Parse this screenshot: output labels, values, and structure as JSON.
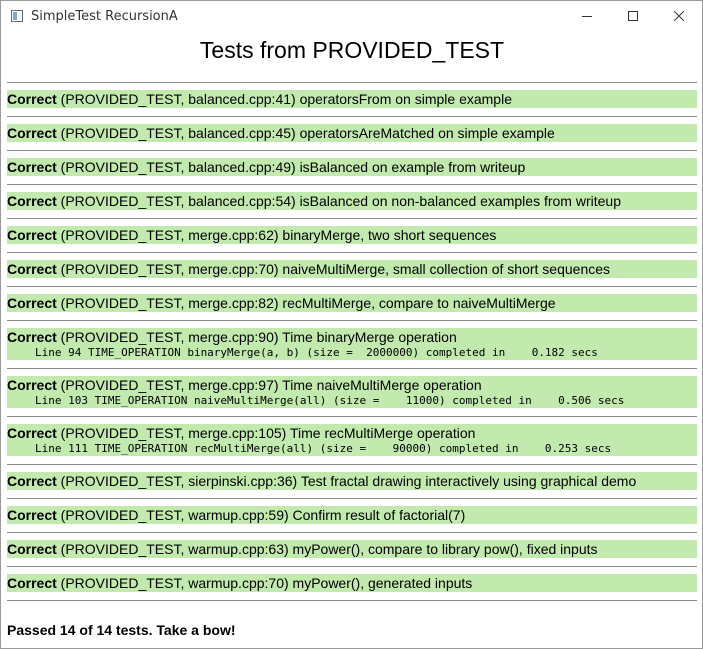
{
  "window": {
    "title": "SimpleTest RecursionA"
  },
  "page": {
    "heading": "Tests from PROVIDED_TEST"
  },
  "tests": [
    {
      "status": "Correct",
      "text": " (PROVIDED_TEST, balanced.cpp:41) operatorsFrom on simple example",
      "detail": ""
    },
    {
      "status": "Correct",
      "text": " (PROVIDED_TEST, balanced.cpp:45) operatorsAreMatched on simple example",
      "detail": ""
    },
    {
      "status": "Correct",
      "text": " (PROVIDED_TEST, balanced.cpp:49) isBalanced on example from writeup",
      "detail": ""
    },
    {
      "status": "Correct",
      "text": " (PROVIDED_TEST, balanced.cpp:54) isBalanced on non-balanced examples from writeup",
      "detail": ""
    },
    {
      "status": "Correct",
      "text": " (PROVIDED_TEST, merge.cpp:62) binaryMerge, two short sequences",
      "detail": ""
    },
    {
      "status": "Correct",
      "text": " (PROVIDED_TEST, merge.cpp:70) naiveMultiMerge, small collection of short sequences",
      "detail": ""
    },
    {
      "status": "Correct",
      "text": " (PROVIDED_TEST, merge.cpp:82) recMultiMerge, compare to naiveMultiMerge",
      "detail": ""
    },
    {
      "status": "Correct",
      "text": " (PROVIDED_TEST, merge.cpp:90) Time binaryMerge operation",
      "detail": "Line 94 TIME_OPERATION binaryMerge(a, b) (size =  2000000) completed in    0.182 secs"
    },
    {
      "status": "Correct",
      "text": " (PROVIDED_TEST, merge.cpp:97) Time naiveMultiMerge operation",
      "detail": "Line 103 TIME_OPERATION naiveMultiMerge(all) (size =    11000) completed in    0.506 secs"
    },
    {
      "status": "Correct",
      "text": " (PROVIDED_TEST, merge.cpp:105) Time recMultiMerge operation",
      "detail": "Line 111 TIME_OPERATION recMultiMerge(all) (size =    90000) completed in    0.253 secs"
    },
    {
      "status": "Correct",
      "text": " (PROVIDED_TEST, sierpinski.cpp:36) Test fractal drawing interactively using graphical demo",
      "detail": ""
    },
    {
      "status": "Correct",
      "text": " (PROVIDED_TEST, warmup.cpp:59) Confirm result of factorial(7)",
      "detail": ""
    },
    {
      "status": "Correct",
      "text": " (PROVIDED_TEST, warmup.cpp:63) myPower(), compare to library pow(), fixed inputs",
      "detail": ""
    },
    {
      "status": "Correct",
      "text": " (PROVIDED_TEST, warmup.cpp:70) myPower(), generated inputs",
      "detail": ""
    }
  ],
  "summary": "Passed 14 of 14 tests. Take a bow!",
  "colors": {
    "pass_row": "#c2eaaf"
  },
  "icons": {
    "app": "app-window-icon",
    "minimize": "minimize-icon",
    "maximize": "maximize-icon",
    "close": "close-icon"
  }
}
